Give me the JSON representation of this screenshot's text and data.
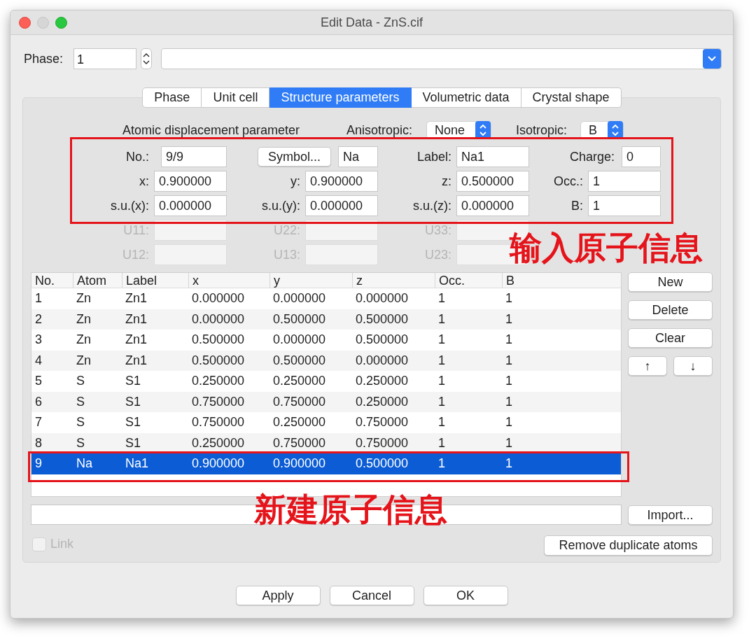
{
  "window": {
    "title": "Edit Data - ZnS.cif"
  },
  "phase": {
    "label": "Phase:",
    "value": "1"
  },
  "tabs": [
    {
      "label": "Phase",
      "selected": false
    },
    {
      "label": "Unit cell",
      "selected": false
    },
    {
      "label": "Structure parameters",
      "selected": true
    },
    {
      "label": "Volumetric data",
      "selected": false
    },
    {
      "label": "Crystal shape",
      "selected": false
    }
  ],
  "adp": {
    "label": "Atomic displacement parameter",
    "anisotropic": {
      "label": "Anisotropic:",
      "value": "None"
    },
    "isotropic": {
      "label": "Isotropic:",
      "value": "B"
    }
  },
  "atom_form": [
    [
      {
        "kind": "field",
        "label": "No.:",
        "value": "9/9",
        "disabled": false
      },
      {
        "kind": "symbol",
        "button": "Symbol...",
        "value": "Na"
      },
      {
        "kind": "field",
        "label": "Label:",
        "value": "Na1",
        "disabled": false
      },
      {
        "kind": "short",
        "label": "Charge:",
        "value": "0",
        "disabled": false
      }
    ],
    [
      {
        "kind": "field",
        "label": "x:",
        "value": "0.900000",
        "disabled": false
      },
      {
        "kind": "field",
        "label": "y:",
        "value": "0.900000",
        "disabled": false
      },
      {
        "kind": "field",
        "label": "z:",
        "value": "0.500000",
        "disabled": false
      },
      {
        "kind": "field",
        "label": "Occ.:",
        "value": "1",
        "disabled": false
      }
    ],
    [
      {
        "kind": "field",
        "label": "s.u.(x):",
        "value": "0.000000",
        "disabled": false
      },
      {
        "kind": "field",
        "label": "s.u.(y):",
        "value": "0.000000",
        "disabled": false
      },
      {
        "kind": "field",
        "label": "s.u.(z):",
        "value": "0.000000",
        "disabled": false
      },
      {
        "kind": "field",
        "label": "B:",
        "value": "1",
        "disabled": false
      }
    ],
    [
      {
        "kind": "field",
        "label": "U11:",
        "disabled": true
      },
      {
        "kind": "field",
        "label": "U22:",
        "disabled": true
      },
      {
        "kind": "field",
        "label": "U33:",
        "disabled": true
      }
    ],
    [
      {
        "kind": "field",
        "label": "U12:",
        "disabled": true
      },
      {
        "kind": "field",
        "label": "U13:",
        "disabled": true
      },
      {
        "kind": "field",
        "label": "U23:",
        "disabled": true
      }
    ]
  ],
  "table": {
    "columns": [
      "No.",
      "Atom",
      "Label",
      "x",
      "y",
      "z",
      "Occ.",
      "B"
    ],
    "rows": [
      {
        "cells": [
          "1",
          "Zn",
          "Zn1",
          "0.000000",
          "0.000000",
          "0.000000",
          "1",
          "1"
        ],
        "selected": false
      },
      {
        "cells": [
          "2",
          "Zn",
          "Zn1",
          "0.000000",
          "0.500000",
          "0.500000",
          "1",
          "1"
        ],
        "selected": false
      },
      {
        "cells": [
          "3",
          "Zn",
          "Zn1",
          "0.500000",
          "0.000000",
          "0.500000",
          "1",
          "1"
        ],
        "selected": false
      },
      {
        "cells": [
          "4",
          "Zn",
          "Zn1",
          "0.500000",
          "0.500000",
          "0.000000",
          "1",
          "1"
        ],
        "selected": false
      },
      {
        "cells": [
          "5",
          "S",
          "S1",
          "0.250000",
          "0.250000",
          "0.250000",
          "1",
          "1"
        ],
        "selected": false
      },
      {
        "cells": [
          "6",
          "S",
          "S1",
          "0.750000",
          "0.750000",
          "0.250000",
          "1",
          "1"
        ],
        "selected": false
      },
      {
        "cells": [
          "7",
          "S",
          "S1",
          "0.750000",
          "0.250000",
          "0.750000",
          "1",
          "1"
        ],
        "selected": false
      },
      {
        "cells": [
          "8",
          "S",
          "S1",
          "0.250000",
          "0.750000",
          "0.750000",
          "1",
          "1"
        ],
        "selected": false
      },
      {
        "cells": [
          "9",
          "Na",
          "Na1",
          "0.900000",
          "0.900000",
          "0.500000",
          "1",
          "1"
        ],
        "selected": true
      }
    ]
  },
  "side_buttons": [
    "New",
    "Delete",
    "Clear"
  ],
  "move_buttons": [
    "↑",
    "↓"
  ],
  "import_button": "Import...",
  "link": {
    "label": "Link",
    "checked": false,
    "disabled": true
  },
  "remove_button": "Remove duplicate atoms",
  "footer_buttons": [
    "Apply",
    "Cancel",
    "OK"
  ],
  "annotations": [
    {
      "text": "输入原子信息"
    },
    {
      "text": "新建原子信息"
    }
  ]
}
